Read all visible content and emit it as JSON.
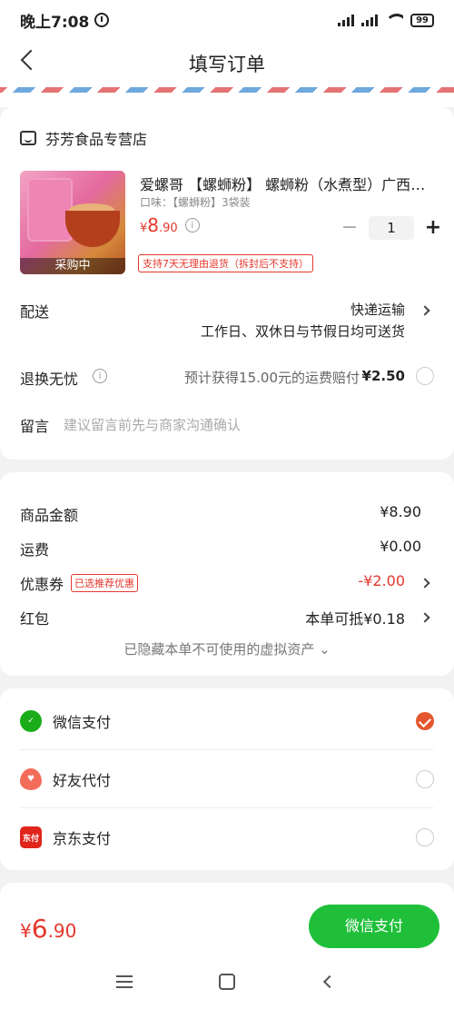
{
  "status_bar": {
    "time": "晚上7:08",
    "battery": "99"
  },
  "header": {
    "title": "填写订单"
  },
  "store": {
    "name": "芬芳食品专营店"
  },
  "product": {
    "name": "爱螺哥 【螺蛳粉】 螺蛳粉（水煮型）广西柳州螺蛳粉",
    "spec": "口味：【螺蛳粉】3袋装",
    "price_symbol": "¥",
    "price_int": "8",
    "price_dec": ".90",
    "quantity": "1",
    "return_policy": "支持7天无理由退货（拆封后不支持）",
    "image_overlay": "采购中"
  },
  "delivery": {
    "label": "配送",
    "method": "快递运输",
    "note": "工作日、双休日与节假日均可送货"
  },
  "return_insurance": {
    "label": "退换无忧",
    "description": "预计获得15.00元的运费赔付",
    "price": "¥2.50"
  },
  "message": {
    "label": "留言",
    "placeholder": "建议留言前先与商家沟通确认"
  },
  "amounts": {
    "goods_label": "商品金额",
    "goods_value": "¥8.90",
    "shipping_label": "运费",
    "shipping_value": "¥0.00",
    "coupon_label": "优惠券",
    "coupon_tag": "已选推荐优惠",
    "coupon_value": "-¥2.00",
    "redpacket_label": "红包",
    "redpacket_value": "本单可抵¥0.18",
    "hidden_note": "已隐藏本单不可使用的虚拟资产 ⌄"
  },
  "payment": {
    "methods": [
      {
        "label": "微信支付",
        "icon": "wechat-pay-icon",
        "selected": true
      },
      {
        "label": "好友代付",
        "icon": "friend-pay-icon",
        "selected": false
      },
      {
        "label": "京东支付",
        "icon": "jd-pay-icon",
        "selected": false
      }
    ]
  },
  "footer": {
    "total_symbol": "¥",
    "total_int": "6",
    "total_dec": ".90",
    "pay_button": "微信支付"
  },
  "colors": {
    "accent": "#e4372c",
    "pay_green": "#1fbf3a",
    "wechat_green": "#1aad19"
  }
}
